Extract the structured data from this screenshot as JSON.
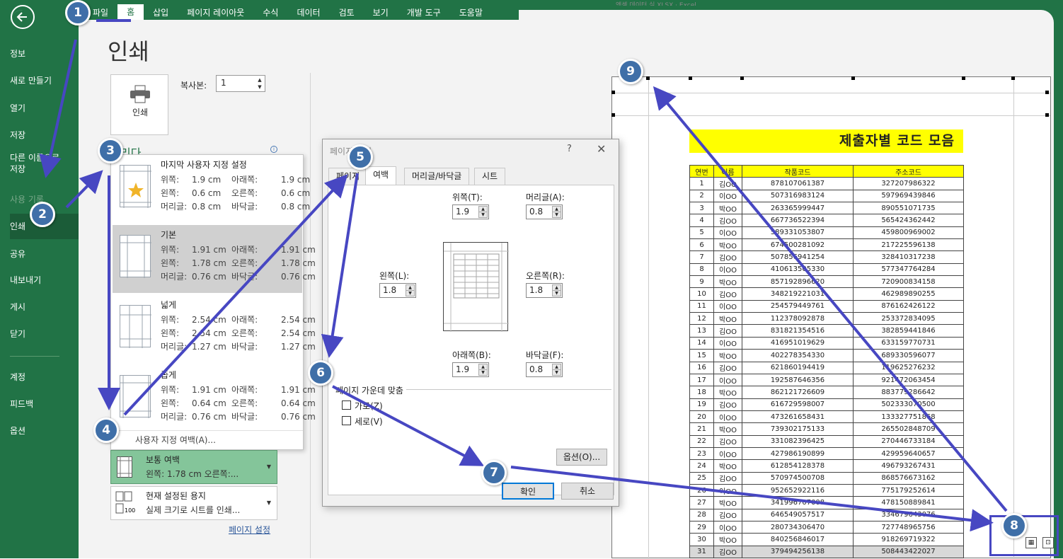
{
  "title_bar": "엑셀 데이터 실 XLSX · Excel",
  "ribbon_tabs": [
    "파일",
    "홈",
    "삽입",
    "페이지 레이아웃",
    "수식",
    "데이터",
    "검토",
    "보기",
    "개발 도구",
    "도움말"
  ],
  "nav": {
    "info": "정보",
    "new": "새로 만들기",
    "open": "열기",
    "save": "저장",
    "save_as": "다른 이름으로\n저장",
    "history": "사용 기록",
    "print": "인쇄",
    "share": "공유",
    "export": "내보내기",
    "publish": "게시",
    "close": "닫기",
    "account": "계정",
    "feedback": "피드백",
    "options": "옵션"
  },
  "page_title": "인쇄",
  "print_button": "인쇄",
  "copies": {
    "label": "복사본:",
    "value": "1"
  },
  "printer_fragment": "리다",
  "margin_presets": [
    {
      "name": "마지막 사용자 지정 설정",
      "top": "1.9 cm",
      "bottom": "1.9 cm",
      "left": "0.6 cm",
      "right": "0.6 cm",
      "header": "0.8 cm",
      "footer": "0.8 cm"
    },
    {
      "name": "기본",
      "top": "1.91 cm",
      "bottom": "1.91 cm",
      "left": "1.78 cm",
      "right": "1.78 cm",
      "header": "0.76 cm",
      "footer": "0.76 cm"
    },
    {
      "name": "넓게",
      "top": "2.54 cm",
      "bottom": "2.54 cm",
      "left": "2.54 cm",
      "right": "2.54 cm",
      "header": "1.27 cm",
      "footer": "1.27 cm"
    },
    {
      "name": "좁게",
      "top": "1.91 cm",
      "bottom": "1.91 cm",
      "left": "0.64 cm",
      "right": "0.64 cm",
      "header": "0.76 cm",
      "footer": "0.76 cm"
    }
  ],
  "margin_labels": {
    "top": "위쪽:",
    "bottom": "아래쪽:",
    "left": "왼쪽:",
    "right": "오른쪽:",
    "header": "머리글:",
    "footer": "바닥글:"
  },
  "custom_margins": "사용자 지정 여백(A)...",
  "margin_setting": {
    "title": "보통 여백",
    "sub": "왼쪽: 1.78 cm 오른쪽:..."
  },
  "paper_setting": {
    "title": "현재 설정된 용지",
    "sub": "실제 크기로 시트를 인쇄..."
  },
  "page_setup_link": "페이지 설정",
  "dialog": {
    "title": "페이지 설정",
    "help": "?",
    "tabs": [
      "페이지",
      "여백",
      "머리글/바닥글",
      "시트"
    ],
    "top_label": "위쪽(T):",
    "top": "1.9",
    "header_label": "머리글(A):",
    "header": "0.8",
    "left_label": "왼쪽(L):",
    "left": "1.8",
    "right_label": "오른쪽(R):",
    "right": "1.8",
    "bottom_label": "아래쪽(B):",
    "bottom": "1.9",
    "footer_label": "바닥글(F):",
    "footer": "0.8",
    "center_section": "페이지 가운데 맞춤",
    "horizontal": "가로(Z)",
    "vertical": "세로(V)",
    "options": "옵션(O)...",
    "ok": "확인",
    "cancel": "취소"
  },
  "sheet": {
    "title": "제출자별 코드 모음",
    "headers": [
      "연번",
      "이름",
      "작품코드",
      "주소코드"
    ],
    "rows": [
      [
        "1",
        "김OO",
        "878107061387",
        "327207986322"
      ],
      [
        "2",
        "이OO",
        "507316983124",
        "597969439846"
      ],
      [
        "3",
        "박OO",
        "263365999447",
        "890551071735"
      ],
      [
        "4",
        "김OO",
        "667736522394",
        "565424362442"
      ],
      [
        "5",
        "이OO",
        "589331053807",
        "459800969002"
      ],
      [
        "6",
        "박OO",
        "674500281092",
        "217225596138"
      ],
      [
        "7",
        "김OO",
        "507856941254",
        "328410317238"
      ],
      [
        "8",
        "이OO",
        "410613505330",
        "577347764284"
      ],
      [
        "9",
        "박OO",
        "857192896620",
        "720900834158"
      ],
      [
        "10",
        "김OO",
        "348219221031",
        "462989890255"
      ],
      [
        "11",
        "이OO",
        "254579449761",
        "876162426122"
      ],
      [
        "12",
        "박OO",
        "112378092878",
        "253372834095"
      ],
      [
        "13",
        "김OO",
        "831821354516",
        "382859441846"
      ],
      [
        "14",
        "이OO",
        "416951019629",
        "633159770731"
      ],
      [
        "15",
        "박OO",
        "402278354330",
        "689330596077"
      ],
      [
        "16",
        "김OO",
        "621860194419",
        "119625276232"
      ],
      [
        "17",
        "이OO",
        "192587646356",
        "921472063454"
      ],
      [
        "18",
        "박OO",
        "862121726609",
        "883779286642"
      ],
      [
        "19",
        "김OO",
        "616729598007",
        "502333070500"
      ],
      [
        "20",
        "이OO",
        "473261658431",
        "133327751868"
      ],
      [
        "21",
        "박OO",
        "739302175133",
        "265502848709"
      ],
      [
        "22",
        "김OO",
        "331082396425",
        "270446733184"
      ],
      [
        "23",
        "이OO",
        "427986190899",
        "429959640657"
      ],
      [
        "24",
        "박OO",
        "612854128378",
        "496793267431"
      ],
      [
        "25",
        "김OO",
        "570974500708",
        "868576673162"
      ],
      [
        "26",
        "이OO",
        "952652922116",
        "775179252614"
      ],
      [
        "27",
        "박OO",
        "341996707008",
        "478150889841"
      ],
      [
        "28",
        "김OO",
        "646549057517",
        "334679643076"
      ],
      [
        "29",
        "이OO",
        "280734306470",
        "727748965756"
      ],
      [
        "30",
        "박OO",
        "840256846017",
        "918269719322"
      ],
      [
        "31",
        "김OO",
        "379494256138",
        "508443422027"
      ]
    ]
  },
  "badges": [
    "1",
    "2",
    "3",
    "4",
    "5",
    "6",
    "7",
    "8",
    "9"
  ],
  "colors": {
    "excel_green": "#217346",
    "badge": "#3f6fa8",
    "arrow": "#4747c2",
    "sheet_highlight": "#ffff00"
  }
}
